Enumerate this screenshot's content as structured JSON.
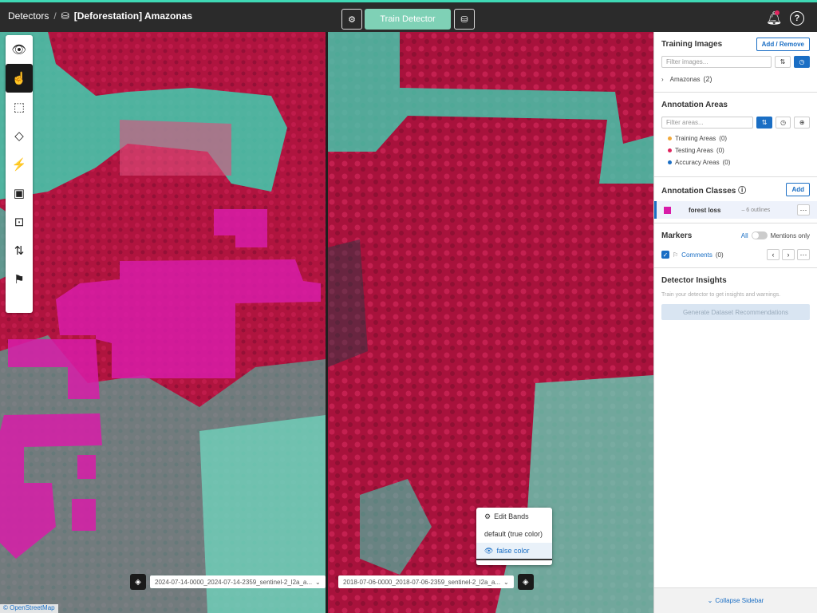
{
  "header": {
    "breadcrumb_root": "Detectors",
    "breadcrumb_sep": "/",
    "project_title": "[Deforestation] Amazonas",
    "train_label": "Train Detector"
  },
  "toolbar": {
    "tools": [
      "eye-icon",
      "pointer-icon",
      "box-select-icon",
      "polygon-icon",
      "magic-wand-icon",
      "crop-icon",
      "zoom-select-icon",
      "swap-icon",
      "flag-icon"
    ]
  },
  "map_left": {
    "date_label": "2024-07-14-0000_2024-07-14-2359_sentinel-2_l2a_a..."
  },
  "map_right": {
    "date_label": "2018-07-06-0000_2018-07-06-2359_sentinel-2_l2a_a..."
  },
  "attribution": "© OpenStreetMap",
  "band_menu": {
    "title": "Edit Bands",
    "option1": "default (true color)",
    "option2": "false color"
  },
  "sidebar": {
    "training_images": {
      "title": "Training Images",
      "button": "Add / Remove",
      "filter_placeholder": "Filter images...",
      "group_name": "Amazonas",
      "group_count": "(2)"
    },
    "annotation_areas": {
      "title": "Annotation Areas",
      "filter_placeholder": "Filter areas...",
      "items": [
        {
          "label": "Training Areas",
          "count": "(0)",
          "color": "#f2a93b"
        },
        {
          "label": "Testing Areas",
          "count": "(0)",
          "color": "#e0245e"
        },
        {
          "label": "Accuracy Areas",
          "count": "(0)",
          "color": "#1a6ec4"
        }
      ]
    },
    "annotation_classes": {
      "title": "Annotation Classes",
      "button": "Add",
      "class_name": "forest loss",
      "class_meta": "– 6 outlines",
      "class_color": "#d81ca8"
    },
    "markers": {
      "title": "Markers",
      "all_label": "All",
      "mentions_label": "Mentions only",
      "comments_label": "Comments",
      "comments_count": "(0)"
    },
    "insights": {
      "title": "Detector Insights",
      "hint": "Train your detector to get insights and warnings.",
      "button": "Generate Dataset Recommendations"
    },
    "collapse_label": "Collapse Sidebar"
  },
  "colors": {
    "accent": "#1a6ec4",
    "teal": "#3fd9b5",
    "magenta": "#d81ca8",
    "forest": "#a3123c"
  }
}
